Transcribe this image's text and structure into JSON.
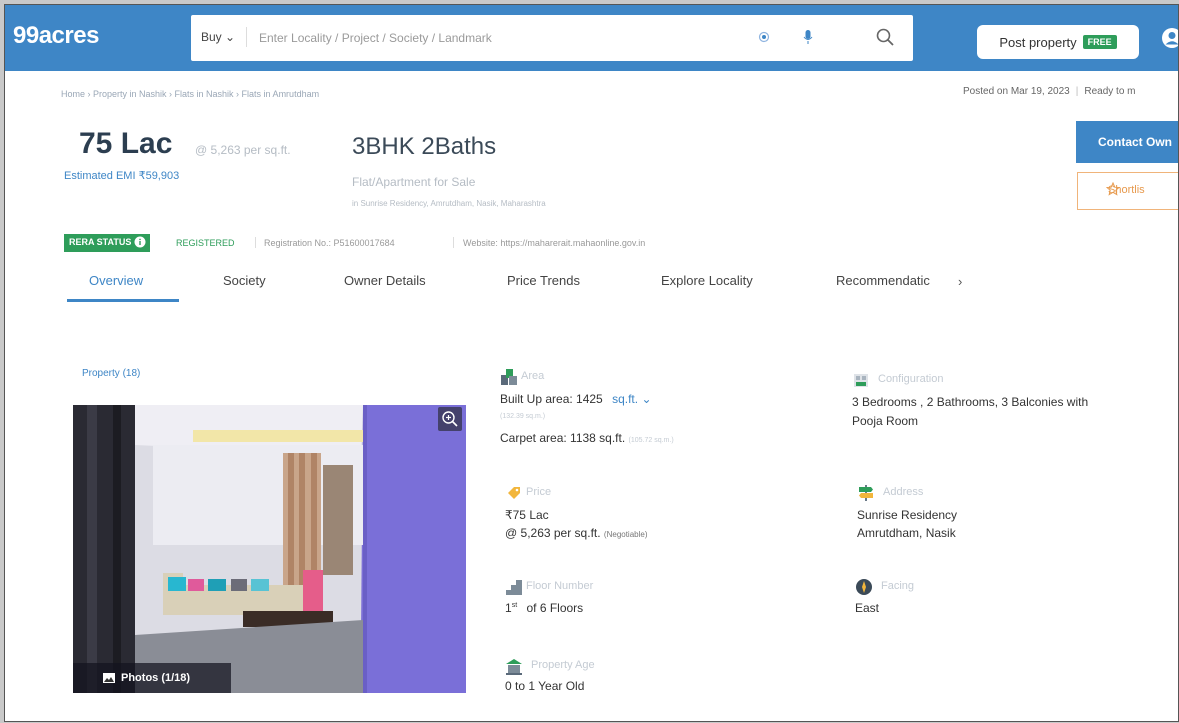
{
  "header": {
    "logo": "99acres",
    "buy_label": "Buy",
    "search_placeholder": "Enter Locality / Project / Society / Landmark",
    "post_property_label": "Post property",
    "free_badge": "FREE",
    "colors": {
      "header_bg": "#3e86c6",
      "free_badge": "#2e9d5a"
    }
  },
  "breadcrumb": "Home › Property in Nashik › Flats in Nashik › Flats in Amrutdham",
  "posted": {
    "date": "Posted on Mar 19, 2023",
    "status": "Ready to m"
  },
  "summary": {
    "price": "75 Lac",
    "price_per": "@ 5,263 per sq.ft.",
    "emi": "Estimated EMI ₹59,903",
    "bhk": "3BHK 2Baths",
    "type": "Flat/Apartment for Sale",
    "address": "in Sunrise Residency, Amrutdham, Nasik, Maharashtra"
  },
  "actions": {
    "contact": "Contact Own",
    "shortlist": "Shortlis"
  },
  "rera": {
    "badge": "RERA STATUS",
    "registered": "REGISTERED",
    "registration": "Registration No.: P51600017684",
    "website": "Website: https://maharerait.mahaonline.gov.in"
  },
  "tabs": [
    {
      "label": "Overview"
    },
    {
      "label": "Society"
    },
    {
      "label": "Owner Details"
    },
    {
      "label": "Price Trends"
    },
    {
      "label": "Explore Locality"
    },
    {
      "label": "Recommendatic"
    }
  ],
  "photos": {
    "label": "Property (18)",
    "count": "Photos (1/18)"
  },
  "details": {
    "area": {
      "label": "Area",
      "builtup": "Built Up area: 1425",
      "unit": "sq.ft.",
      "builtup_sqm": "(132.39 sq.m.)",
      "carpet": "Carpet area: 1138 sq.ft.",
      "carpet_sqm": "(105.72 sq.m.)"
    },
    "configuration": {
      "label": "Configuration",
      "line1": "3 Bedrooms , 2 Bathrooms, 3 Balconies with",
      "line2": "Pooja Room"
    },
    "price": {
      "label": "Price",
      "value": "₹75 Lac",
      "per": "@ 5,263 per sq.ft.",
      "negotiable": "(Negotiable)"
    },
    "address": {
      "label": "Address",
      "line1": "Sunrise Residency",
      "line2": "Amrutdham, Nasik"
    },
    "floor": {
      "label": "Floor Number",
      "floor": "1",
      "suffix": "st",
      "total": "of 6 Floors"
    },
    "facing": {
      "label": "Facing",
      "value": "East"
    },
    "age": {
      "label": "Property Age",
      "value": "0 to 1 Year Old"
    }
  }
}
